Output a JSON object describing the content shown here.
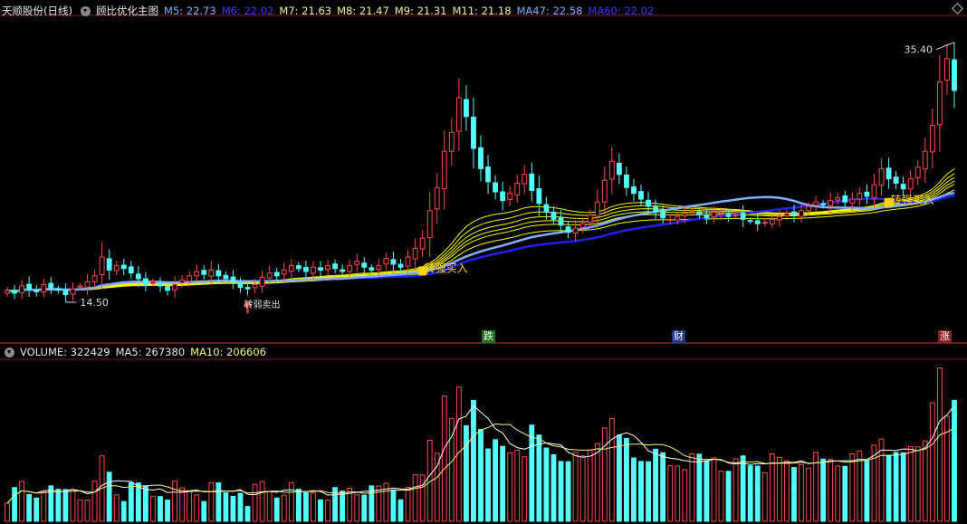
{
  "header": {
    "stock": "天顺股份(日线)",
    "indicator": "顾比优化主图",
    "items": [
      {
        "label": "M5: 22.73",
        "color": "#e8e8e8"
      },
      {
        "label": "M6: 22.02",
        "color": "#3a3aff"
      },
      {
        "label": "M7: 21.63",
        "color": "#f2f2a0"
      },
      {
        "label": "M8: 21.47",
        "color": "#f2f2a0"
      },
      {
        "label": "M9: 21.31",
        "color": "#f2f2a0"
      },
      {
        "label": "M11: 21.18",
        "color": "#f2f2a0"
      },
      {
        "label": "MA47: 22.58",
        "color": "#7fb0ff"
      },
      {
        "label": "MA60: 22.02",
        "color": "#3a3aff"
      }
    ]
  },
  "price_labels": {
    "high": "35.40",
    "low": "14.50"
  },
  "signals": {
    "buy_text": "转强买入",
    "weak_text": "转弱卖出"
  },
  "events": {
    "fall": "跌",
    "finance": "财",
    "rise": "涨"
  },
  "volume_header": {
    "volume": "VOLUME: 322429",
    "ma5": "MA5: 267380",
    "ma10": "MA10: 206606"
  },
  "colors": {
    "up": "#ff4a4a",
    "down": "#54fcfc",
    "ma5": "#ffffff",
    "ma10": "#f7f77a",
    "ma47": "#7fb0ff",
    "ma60": "#2020ff",
    "gmma": "#f7f700",
    "buy": "#ffd200"
  },
  "chart_data": {
    "type": "candlestick",
    "closes": [
      17.2,
      17.0,
      17.5,
      17.3,
      17.1,
      17.6,
      17.4,
      17.2,
      16.9,
      17.3,
      17.5,
      17.8,
      18.2,
      19.5,
      18.6,
      18.9,
      18.7,
      18.4,
      18.0,
      17.6,
      17.8,
      17.5,
      17.2,
      17.6,
      17.9,
      18.2,
      18.5,
      18.3,
      18.6,
      18.2,
      18.0,
      17.8,
      17.4,
      17.3,
      17.6,
      18.1,
      18.4,
      18.2,
      18.6,
      18.9,
      18.7,
      18.5,
      18.8,
      18.6,
      18.9,
      18.7,
      18.5,
      18.9,
      19.2,
      18.8,
      18.6,
      18.9,
      19.4,
      19.0,
      18.8,
      19.5,
      20.1,
      20.8,
      22.7,
      24.3,
      26.8,
      28.1,
      30.5,
      29.2,
      27.0,
      25.6,
      24.7,
      24.0,
      23.4,
      23.9,
      24.6,
      25.2,
      24.1,
      23.2,
      22.6,
      22.1,
      21.7,
      21.2,
      21.5,
      21.8,
      22.4,
      23.3,
      24.8,
      26.1,
      25.2,
      24.3,
      23.9,
      23.5,
      23.0,
      22.6,
      22.2,
      22.1,
      22.3,
      22.5,
      22.7,
      22.4,
      22.2,
      22.6,
      22.5,
      22.3,
      22.4,
      22.1,
      22.0,
      21.8,
      21.9,
      22.1,
      22.3,
      22.5,
      22.4,
      22.7,
      23.0,
      23.3,
      23.1,
      23.4,
      23.6,
      23.3,
      23.5,
      23.9,
      23.7,
      24.5,
      25.6,
      24.9,
      24.6,
      24.2,
      24.9,
      25.7,
      26.8,
      28.6,
      31.6,
      33.2,
      31.0
    ]
  }
}
